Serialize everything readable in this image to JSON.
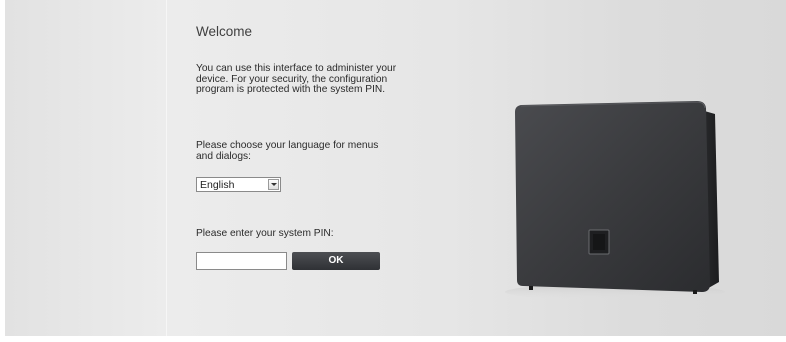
{
  "welcome": {
    "title": "Welcome",
    "intro": "You can use this interface to administer your device. For your security, the configuration program is protected with the system PIN."
  },
  "language": {
    "prompt": "Please choose your language for menus and dialogs:",
    "selected": "English"
  },
  "pin": {
    "prompt": "Please enter your system PIN:",
    "value": "",
    "ok_label": "OK"
  },
  "device_image": {
    "icon": "base-station-device"
  },
  "colors": {
    "button_bg": "#3a3c40",
    "button_text": "#ffffff",
    "title_text": "#3f3f3f",
    "body_text": "#2b2b2b"
  }
}
